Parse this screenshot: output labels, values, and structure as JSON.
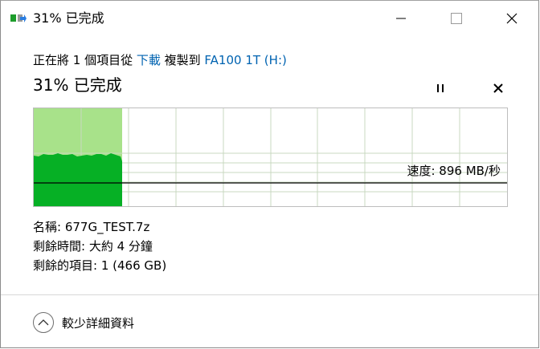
{
  "window": {
    "title": "31% 已完成",
    "buttons": {
      "minimize": "minimize",
      "maximize": "maximize",
      "close": "close"
    }
  },
  "copy": {
    "prefix": "正在將 1 個項目從 ",
    "source": "下載",
    "middle": " 複製到 ",
    "destination": "FA100 1T (H:)",
    "progress_heading": "31% 已完成",
    "progress_fraction": 0.31
  },
  "graph": {
    "speed_label": "速度: 896 MB/秒",
    "colors": {
      "completed_area": "#a8e28a",
      "speed_area": "#06b025",
      "grid": "#c8d8c0",
      "speed_line": "#000000"
    }
  },
  "details": {
    "name_label": "名稱:",
    "name_value": "677G_TEST.7z",
    "time_label": "剩餘時間:",
    "time_value": "大約 4 分鐘",
    "items_label": "剩餘的項目:",
    "items_value": "1 (466 GB)"
  },
  "footer": {
    "more_details": "較少詳細資料"
  },
  "icons": [
    "copy-progress-icon",
    "minimize-icon",
    "maximize-icon",
    "close-icon",
    "pause-icon",
    "cancel-icon",
    "chevron-up-icon"
  ]
}
